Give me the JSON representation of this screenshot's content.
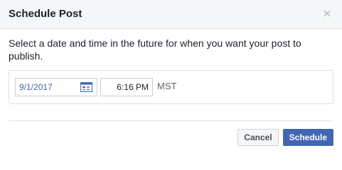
{
  "dialog": {
    "title": "Schedule Post",
    "close_icon": "close-icon",
    "description": "Select a date and time in the future for when you want your post to publish."
  },
  "picker": {
    "date_value": "9/1/2017",
    "calendar_icon": "calendar-icon",
    "time_value": "6:16 PM",
    "timezone": "MST"
  },
  "footer": {
    "cancel_label": "Cancel",
    "schedule_label": "Schedule"
  },
  "colors": {
    "accent": "#4267b2",
    "header_bg": "#f5f6f7",
    "text": "#1d2129"
  }
}
